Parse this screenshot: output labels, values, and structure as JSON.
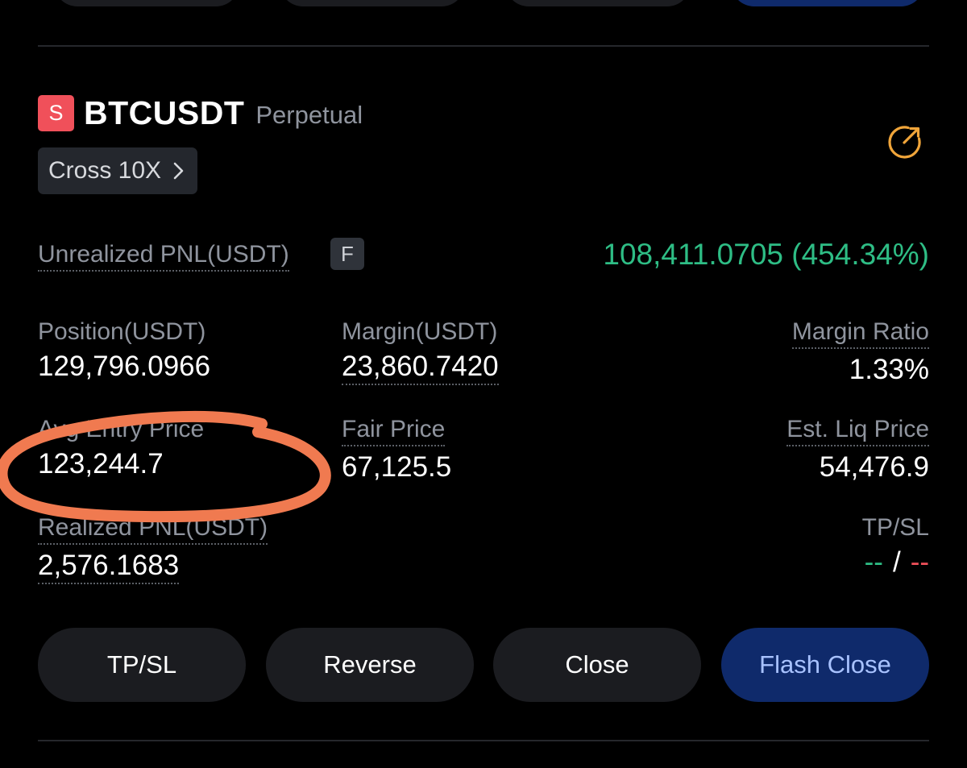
{
  "position": {
    "side_badge": "S",
    "symbol": "BTCUSDT",
    "contract_type": "Perpetual",
    "margin_mode": "Cross 10X",
    "unrealized_pnl_label": "Unrealized PNL(USDT)",
    "unrealized_pnl_badge": "F",
    "unrealized_pnl_value": "108,411.0705 (454.34%)",
    "fields": {
      "position_label": "Position(USDT)",
      "position_value": "129,796.0966",
      "margin_label": "Margin(USDT)",
      "margin_value": "23,860.7420",
      "margin_ratio_label": "Margin Ratio",
      "margin_ratio_value": "1.33%",
      "avg_entry_label": "Avg Entry Price",
      "avg_entry_value": "123,244.7",
      "fair_price_label": "Fair Price",
      "fair_price_value": "67,125.5",
      "liq_price_label": "Est. Liq Price",
      "liq_price_value": "54,476.9",
      "realized_pnl_label": "Realized PNL(USDT)",
      "realized_pnl_value": "2,576.1683",
      "tpsl_label": "TP/SL",
      "tp_value": "--",
      "tpsl_separator": "/",
      "sl_value": "--"
    },
    "actions": {
      "tpsl": "TP/SL",
      "reverse": "Reverse",
      "close": "Close",
      "flash_close": "Flash Close"
    }
  },
  "icons": {
    "share": "share-icon",
    "chevron": "chevron-right-icon"
  },
  "colors": {
    "background": "#000000",
    "profit_green": "#2ebd85",
    "loss_red": "#f0505a",
    "share_icon": "#f0a53a",
    "flash_close_bg": "#0f2a6b",
    "annotation_stroke": "#f07a50"
  }
}
